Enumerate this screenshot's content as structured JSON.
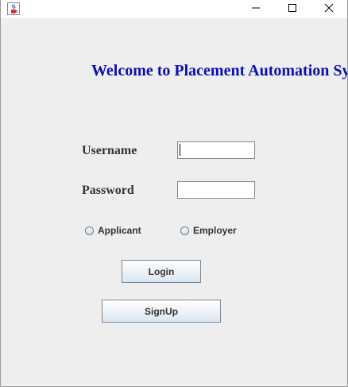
{
  "window": {
    "icons": {
      "app": "java-cup-icon",
      "minimize": "minimize-icon",
      "maximize": "maximize-icon",
      "close": "close-icon"
    }
  },
  "form": {
    "welcome": "Welcome to Placement Automation Sy",
    "username_label": "Username",
    "password_label": "Password",
    "username_value": "",
    "password_value": "",
    "role_options": [
      "Applicant",
      "Employer"
    ],
    "login_label": "Login",
    "signup_label": "SignUp"
  },
  "colors": {
    "welcome_text": "#0a10b0",
    "background": "#eeeeee"
  }
}
